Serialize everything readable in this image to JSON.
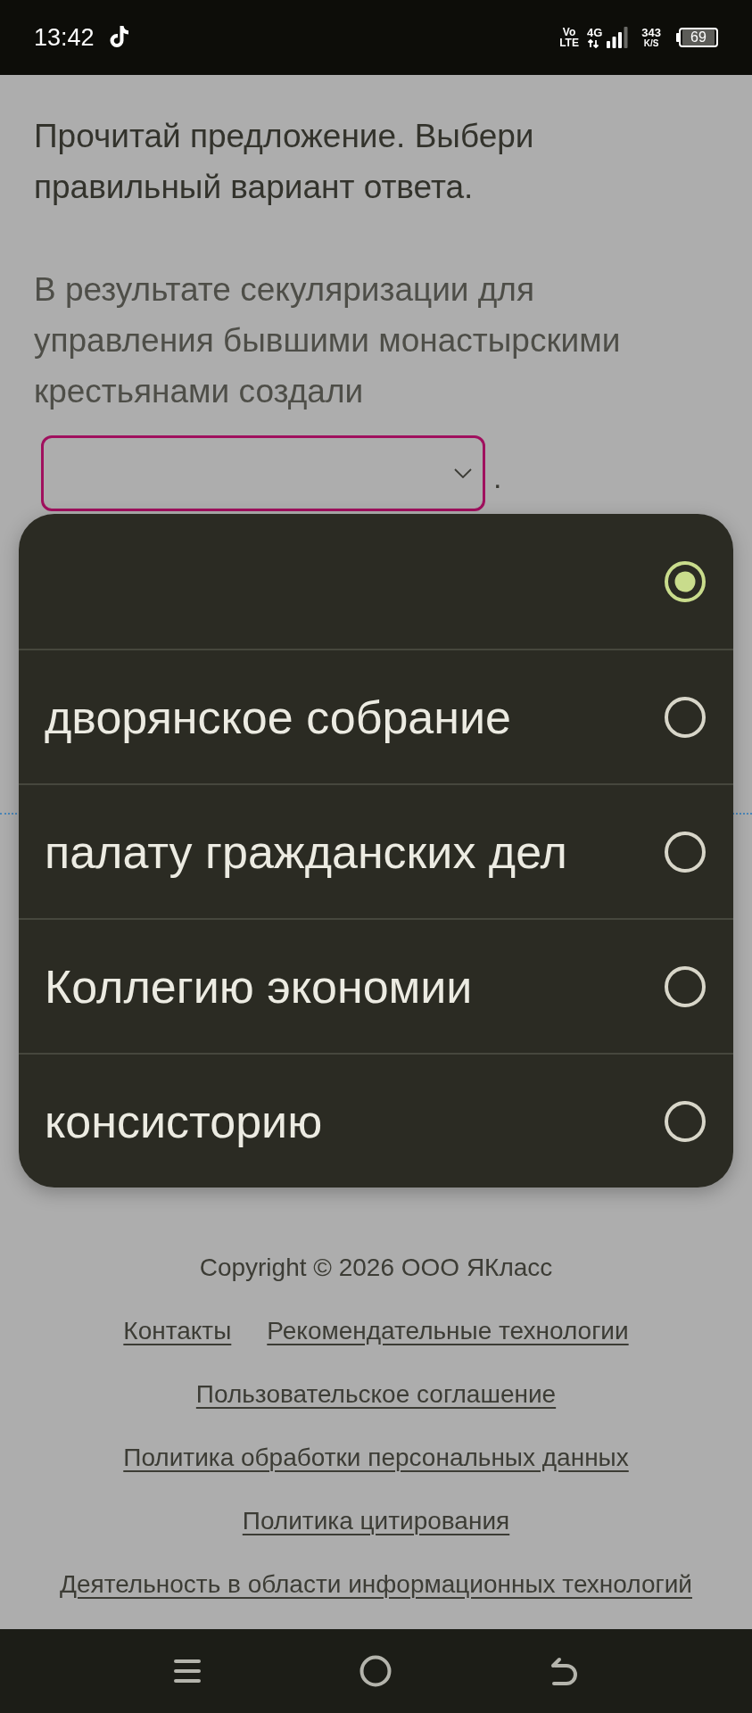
{
  "status_bar": {
    "time": "13:42",
    "volte": "Vo LTE",
    "network": "4G",
    "speed": "343",
    "speed_unit": "K/S",
    "battery": "69"
  },
  "question": {
    "instruction": "Прочитай предложение. Выбери правильный вариант ответа.",
    "sentence": "В результате секуляризации для управления бывшими монастырскими крестьянами создали",
    "after_blank": "."
  },
  "dropdown": {
    "expanded": true,
    "options": [
      {
        "selected": true
      },
      {
        "label": "дворянское собрание",
        "selected": false
      },
      {
        "label": "палату гражданских дел",
        "selected": false
      },
      {
        "label": "Коллегию экономии",
        "selected": false
      },
      {
        "label": "консисторию",
        "selected": false
      }
    ]
  },
  "footer": {
    "copyright": "Copyright © 2026 ООО ЯКласс",
    "link_rows": [
      [
        "Контакты",
        "Рекомендательные технологии"
      ],
      [
        "Пользовательское соглашение"
      ],
      [
        "Политика обработки персональных данных"
      ],
      [
        "Политика цитирования"
      ],
      [
        "Деятельность в области информационных технологий"
      ]
    ]
  }
}
